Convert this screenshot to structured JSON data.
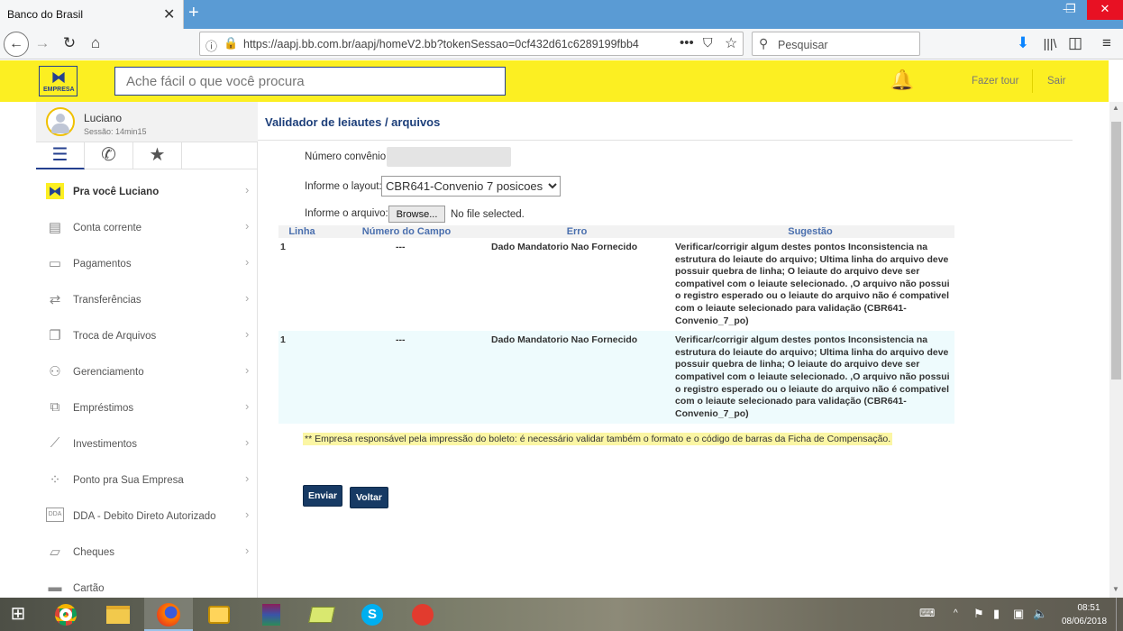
{
  "browser": {
    "tab_title": "Banco do Brasil",
    "tab_close": "✕",
    "new_tab": "+",
    "url": "https://aapj.bb.com.br/aapj/homeV2.bb?tokenSessao=0cf432d61c6289199fbb4",
    "url_menu": "•••",
    "search_placeholder": "Pesquisar"
  },
  "header": {
    "logo_text": "EMPRESA",
    "search_placeholder": "Ache fácil o que você procura",
    "tour_label": "Fazer tour",
    "logout_label": "Sair"
  },
  "user": {
    "name": "Luciano",
    "session": "Sessão: 14min15"
  },
  "menu": [
    {
      "label": "Pra você Luciano",
      "icon": "bb-logo-icon"
    },
    {
      "label": "Conta corrente",
      "icon": "wallet-icon"
    },
    {
      "label": "Pagamentos",
      "icon": "barcode-icon"
    },
    {
      "label": "Transferências",
      "icon": "transfer-icon"
    },
    {
      "label": "Troca de Arquivos",
      "icon": "files-icon"
    },
    {
      "label": "Gerenciamento",
      "icon": "people-icon"
    },
    {
      "label": "Empréstimos",
      "icon": "loan-icon"
    },
    {
      "label": "Investimentos",
      "icon": "chart-icon"
    },
    {
      "label": "Ponto pra Sua Empresa",
      "icon": "points-icon"
    },
    {
      "label": "DDA - Debito Direto Autorizado",
      "icon": "dda-icon"
    },
    {
      "label": "Cheques",
      "icon": "cheque-icon"
    },
    {
      "label": "Cartão",
      "icon": "card-icon"
    }
  ],
  "page": {
    "title": "Validador de leiautes / arquivos",
    "convenio_label": "Número convênio",
    "layout_label": "Informe o layout:",
    "layout_value": "CBR641-Convenio 7 posicoes",
    "file_label": "Informe o arquivo:",
    "browse_label": "Browse...",
    "no_file": "No file selected.",
    "table": {
      "headers": [
        "Linha",
        "Número do Campo",
        "Erro",
        "Sugestão"
      ],
      "rows": [
        [
          "1",
          "---",
          "Dado Mandatorio Nao Fornecido",
          "Verificar/corrigir algum destes pontos Inconsistencia na estrutura do leiaute do arquivo; Ultima linha do arquivo deve possuir quebra de linha; O leiaute do arquivo deve ser compativel com o leiaute selecionado. ,O arquivo não possui o registro esperado ou o leiaute do arquivo não é compativel com o leiaute selecionado para validação (CBR641-Convenio_7_po)"
        ],
        [
          "1",
          "---",
          "Dado Mandatorio Nao Fornecido",
          "Verificar/corrigir algum destes pontos Inconsistencia na estrutura do leiaute do arquivo; Ultima linha do arquivo deve possuir quebra de linha; O leiaute do arquivo deve ser compativel com o leiaute selecionado. ,O arquivo não possui o registro esperado ou o leiaute do arquivo não é compativel com o leiaute selecionado para validação (CBR641-Convenio_7_po)"
        ]
      ]
    },
    "note": "** Empresa responsável pela impressão do boleto: é necessário validar também o formato e o código de barras da Ficha de Compensação.",
    "submit_label": "Enviar",
    "back_label": "Voltar"
  },
  "taskbar": {
    "time": "08:51",
    "date": "08/06/2018"
  },
  "colors": {
    "header_yellow": "#fcef22",
    "bb_blue": "#25408f",
    "button_navy": "#173a64",
    "title_blue": "#1d3f7a"
  }
}
